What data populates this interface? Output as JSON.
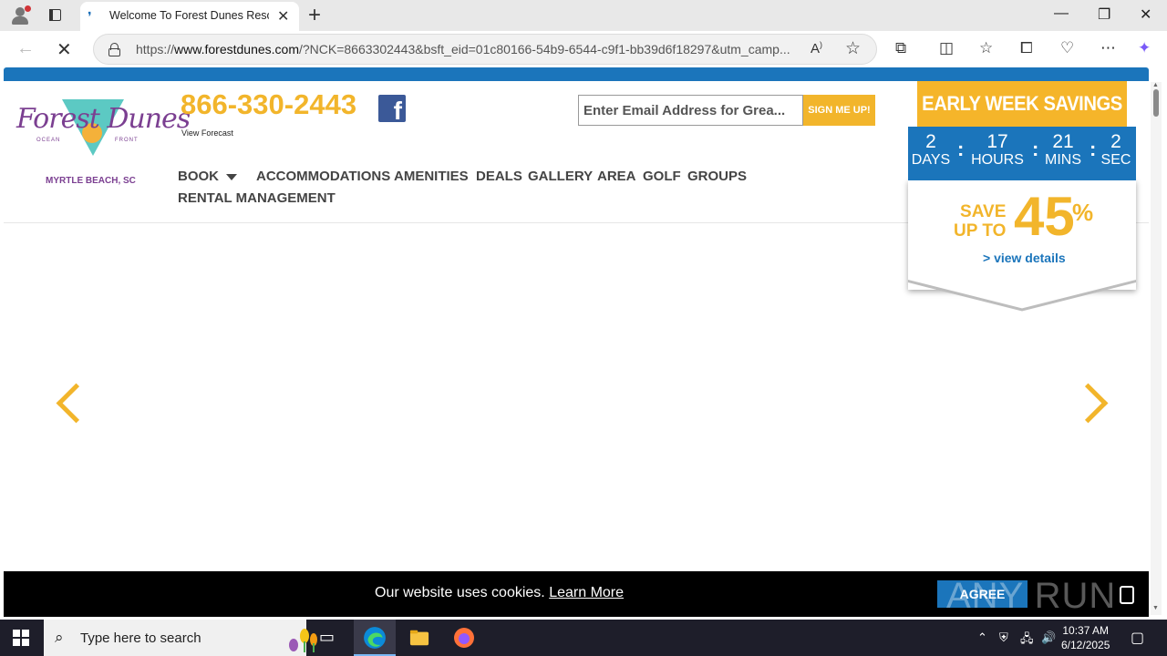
{
  "browser": {
    "tab_title": "Welcome To Forest Dunes Resort",
    "url_prefix": "https://",
    "url_domain": "www.forestdunes.com",
    "url_rest": "/?NCK=8663302443&bsft_eid=01c80166-54b9-6544-c9f1-bb39d6f18297&utm_camp..."
  },
  "site": {
    "logo_script": "Forest Dunes",
    "logo_small_left": "OCEAN",
    "logo_small_right": "FRONT",
    "logo_city": "MYRTLE BEACH, SC",
    "phone": "866-330-2443",
    "facebook_letter": "f",
    "forecast": "View Forecast",
    "email_placeholder": "Enter Email Address for Grea...",
    "signup_label": "SIGN ME UP!",
    "menu": [
      {
        "label": "BOOK"
      },
      {
        "label": "ACCOMMODATIONS"
      },
      {
        "label": "AMENITIES"
      },
      {
        "label": "DEALS"
      },
      {
        "label": "GALLERY"
      },
      {
        "label": "AREA"
      },
      {
        "label": "GOLF"
      },
      {
        "label": "GROUPS"
      },
      {
        "label": "RENTAL MANAGEMENT"
      }
    ]
  },
  "savings": {
    "heading": "EARLY WEEK SAVINGS",
    "countdown": [
      {
        "num": "2",
        "label": "DAYS"
      },
      {
        "num": "17",
        "label": "HOURS"
      },
      {
        "num": "21",
        "label": "MINS"
      },
      {
        "num": "2",
        "label": "SEC"
      }
    ],
    "colon": ":",
    "save_line1": "SAVE",
    "save_line2": "UP TO",
    "percent": "45",
    "percent_sign": "%",
    "view_details": "> view details"
  },
  "cookie": {
    "message": "Our website uses cookies.",
    "learn_more": "Learn More",
    "agree": "AGREE",
    "watermark": "ANY RUN"
  },
  "taskbar": {
    "search_placeholder": "Type here to search",
    "time": "10:37 AM",
    "date": "6/12/2025"
  },
  "colors": {
    "brand_blue": "#1b75bb",
    "brand_gold": "#f2b52b",
    "logo_purple": "#7b3f91"
  }
}
